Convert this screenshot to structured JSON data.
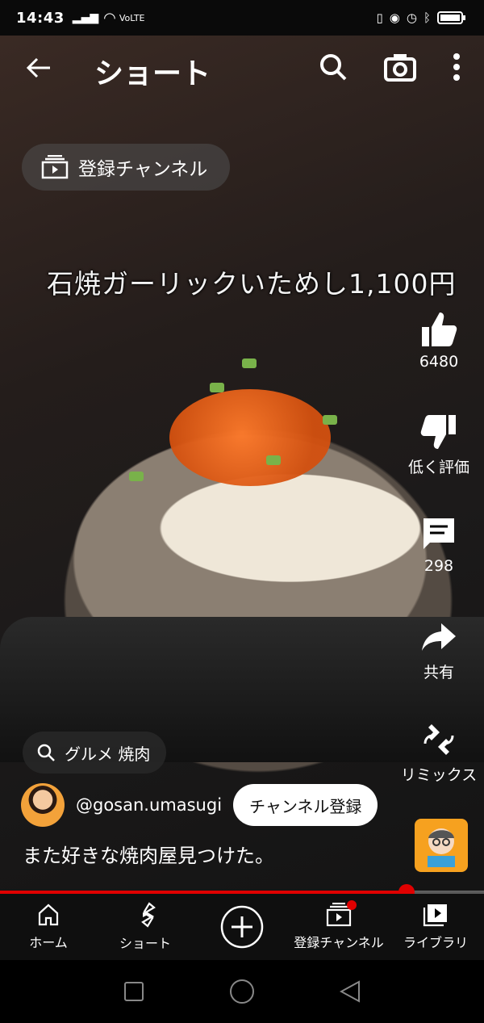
{
  "status_bar": {
    "time": "14:43",
    "network": "VoLTE"
  },
  "header": {
    "title": "ショート"
  },
  "video": {
    "caption_overlay": "石焼ガーリックいためし1,100円",
    "subscribed_chip": "登録チャンネル",
    "search_chip": "グルメ 焼肉",
    "progress_fraction": 0.84
  },
  "actions": {
    "like_count": "6480",
    "dislike_label": "低く評価",
    "comments_count": "298",
    "share_label": "共有",
    "remix_label": "リミックス"
  },
  "channel": {
    "handle": "@gosan.umasugi",
    "subscribe_label": "チャンネル登録",
    "description": "また好きな焼肉屋見つけた。"
  },
  "bottom_nav": {
    "items": [
      {
        "label": "ホーム",
        "icon": "home-icon"
      },
      {
        "label": "ショート",
        "icon": "shorts-icon"
      },
      {
        "label": "",
        "icon": "create-plus-icon"
      },
      {
        "label": "登録チャンネル",
        "icon": "subscriptions-icon"
      },
      {
        "label": "ライブラリ",
        "icon": "library-icon"
      }
    ]
  },
  "colors": {
    "accent": "#e00000",
    "nav_bg": "#0f0f0f"
  }
}
